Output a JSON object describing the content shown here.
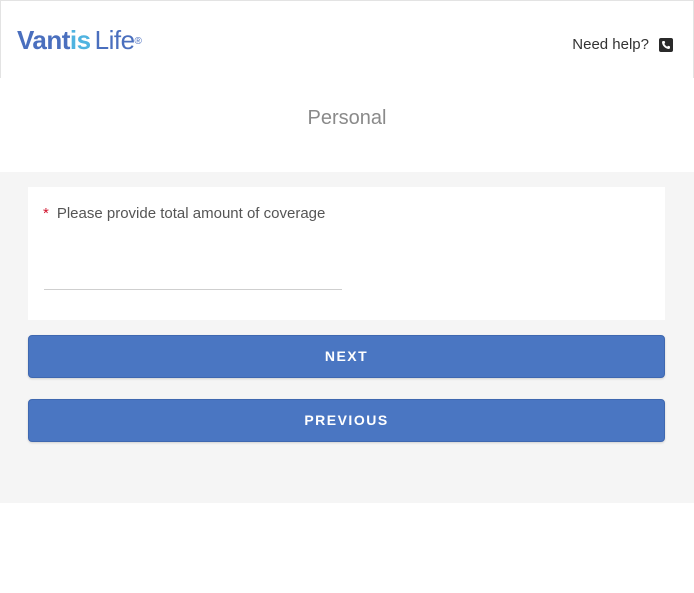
{
  "header": {
    "logo": {
      "part1": "Vant",
      "part2": "is",
      "part3": "Life",
      "registered": "®"
    },
    "help_label": "Need help?",
    "help_icon": "phone-icon"
  },
  "page": {
    "section_title": "Personal"
  },
  "form": {
    "question": {
      "required_mark": "*",
      "label": "Please provide total amount of coverage",
      "value": "",
      "placeholder": ""
    },
    "next_label": "NEXT",
    "previous_label": "PREVIOUS"
  },
  "colors": {
    "brand_blue": "#4a6fbe",
    "brand_light_blue": "#4fb3e0",
    "button_blue": "#4a76c2",
    "required_red": "#d0112b"
  }
}
